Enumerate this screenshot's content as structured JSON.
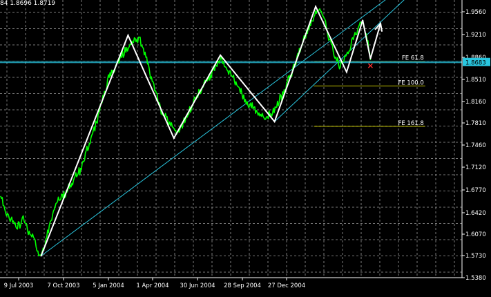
{
  "header": {
    "ohlc_text": "84 1.8696 1.8719"
  },
  "colors": {
    "background": "#000000",
    "grid": "#7a7a7a",
    "price_line": "#00ff00",
    "zigzag": "#ffffff",
    "trendline": "#29c6df",
    "fibo_level": "#c8c800",
    "current_price_bg": "#29c6df",
    "marker": "#ff3030",
    "axis_text": "#ffffff"
  },
  "chart_data": {
    "type": "line",
    "title": "",
    "x_tick_labels": [
      "9 Jul 2003",
      "7 Oct 2003",
      "5 Jan 2004",
      "1 Apr 2004",
      "30 Jun 2004",
      "28 Sep 2004",
      "27 Dec 2004"
    ],
    "y_tick_labels": [
      "1.9560",
      "1.9210",
      "1.8860",
      "1.8510",
      "1.8160",
      "1.7810",
      "1.7460",
      "1.7120",
      "1.6770",
      "1.6420",
      "1.6070",
      "1.5730",
      "1.5380"
    ],
    "ylim": [
      1.534,
      1.963
    ],
    "current_price": "1.8683",
    "horizontal_line_price": 1.8683,
    "grid": true,
    "series": [
      {
        "name": "",
        "style": "price",
        "points": [
          [
            "2003-06-28",
            1.66
          ],
          [
            "2003-07-05",
            1.64
          ],
          [
            "2003-07-14",
            1.625
          ],
          [
            "2003-07-25",
            1.61
          ],
          [
            "2003-08-05",
            1.625
          ],
          [
            "2003-08-15",
            1.605
          ],
          [
            "2003-08-25",
            1.59
          ],
          [
            "2003-09-03",
            1.565
          ],
          [
            "2003-09-12",
            1.59
          ],
          [
            "2003-09-22",
            1.63
          ],
          [
            "2003-10-03",
            1.655
          ],
          [
            "2003-10-15",
            1.665
          ],
          [
            "2003-10-27",
            1.68
          ],
          [
            "2003-11-08",
            1.7
          ],
          [
            "2003-11-20",
            1.73
          ],
          [
            "2003-12-02",
            1.76
          ],
          [
            "2003-12-14",
            1.8
          ],
          [
            "2003-12-26",
            1.84
          ],
          [
            "2004-01-07",
            1.86
          ],
          [
            "2004-01-20",
            1.88
          ],
          [
            "2004-02-02",
            1.895
          ],
          [
            "2004-02-16",
            1.905
          ],
          [
            "2004-02-27",
            1.875
          ],
          [
            "2004-03-10",
            1.835
          ],
          [
            "2004-03-25",
            1.79
          ],
          [
            "2004-04-07",
            1.775
          ],
          [
            "2004-04-20",
            1.76
          ],
          [
            "2004-05-05",
            1.78
          ],
          [
            "2004-05-20",
            1.81
          ],
          [
            "2004-06-05",
            1.835
          ],
          [
            "2004-06-20",
            1.855
          ],
          [
            "2004-07-02",
            1.87
          ],
          [
            "2004-07-15",
            1.855
          ],
          [
            "2004-07-30",
            1.83
          ],
          [
            "2004-08-15",
            1.805
          ],
          [
            "2004-09-01",
            1.79
          ],
          [
            "2004-09-15",
            1.78
          ],
          [
            "2004-09-28",
            1.79
          ],
          [
            "2004-10-12",
            1.815
          ],
          [
            "2004-10-26",
            1.845
          ],
          [
            "2004-11-08",
            1.875
          ],
          [
            "2004-11-20",
            1.905
          ],
          [
            "2004-12-01",
            1.93
          ],
          [
            "2004-12-12",
            1.95
          ],
          [
            "2004-12-22",
            1.935
          ],
          [
            "2004-12-30",
            1.905
          ],
          [
            "2005-01-08",
            1.88
          ],
          [
            "2005-01-17",
            1.86
          ],
          [
            "2005-01-26",
            1.87
          ],
          [
            "2005-02-05",
            1.895
          ],
          [
            "2005-02-15",
            1.915
          ],
          [
            "2005-02-25",
            1.93
          ],
          [
            "2005-03-03",
            1.91
          ],
          [
            "2005-03-10",
            1.87
          ]
        ]
      },
      {
        "name": "",
        "style": "zigzag",
        "points": [
          [
            "2003-09-04",
            1.5676
          ],
          [
            "2004-01-28",
            1.9085
          ],
          [
            "2004-04-14",
            1.7496
          ],
          [
            "2004-07-01",
            1.8777
          ],
          [
            "2004-09-30",
            1.7751
          ],
          [
            "2004-12-08",
            1.9529
          ],
          [
            "2005-01-29",
            1.8517
          ],
          [
            "2005-02-25",
            1.9317
          ],
          [
            "2005-03-10",
            1.8723
          ]
        ]
      },
      {
        "name": "",
        "style": "projection",
        "points": [
          [
            "2005-03-10",
            1.8723
          ],
          [
            "2005-03-27",
            1.9268
          ]
        ]
      }
    ],
    "trendlines": [
      {
        "from": [
          "2003-09-04",
          1.5676
        ],
        "to": [
          "2005-05-25",
          1.998
        ]
      },
      {
        "from": [
          "2004-09-30",
          1.7751
        ],
        "to": [
          "2005-05-25",
          1.98
        ]
      }
    ],
    "fibo_levels": [
      {
        "label": "FE 61.8",
        "price": 1.8683,
        "from": "2004-12-05",
        "to": "2005-06-10"
      },
      {
        "label": "FE 100.0",
        "price": 1.8301,
        "from": "2004-12-05",
        "to": "2005-06-10"
      },
      {
        "label": "FE 161.8",
        "price": 1.7678,
        "from": "2004-12-05",
        "to": "2005-06-10"
      }
    ],
    "markers": [
      {
        "shape": "x",
        "date": "2005-03-10",
        "price": 1.8615
      }
    ]
  }
}
